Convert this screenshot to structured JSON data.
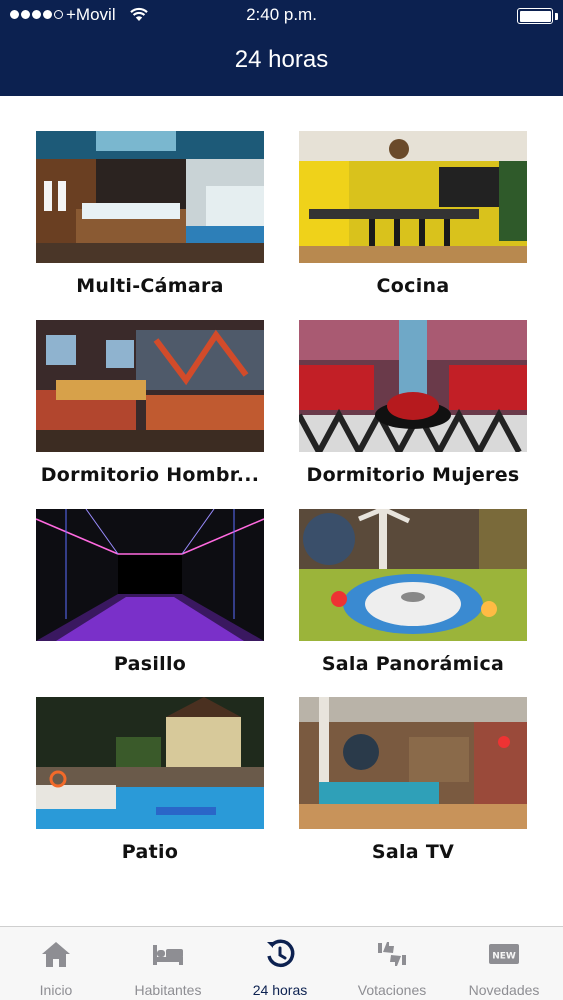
{
  "status_bar": {
    "carrier": "+Movil",
    "time": "2:40 p.m."
  },
  "header": {
    "title": "24 horas"
  },
  "rooms": [
    {
      "label": "Multi-Cámara"
    },
    {
      "label": "Cocina"
    },
    {
      "label": "Dormitorio Hombr..."
    },
    {
      "label": "Dormitorio Mujeres"
    },
    {
      "label": "Pasillo"
    },
    {
      "label": "Sala Panorámica"
    },
    {
      "label": "Patio"
    },
    {
      "label": "Sala TV"
    }
  ],
  "tabbar": {
    "items": [
      {
        "label": "Inicio",
        "icon": "home-icon"
      },
      {
        "label": "Habitantes",
        "icon": "bed-icon"
      },
      {
        "label": "24 horas",
        "icon": "clock-refresh-icon",
        "active": true
      },
      {
        "label": "Votaciones",
        "icon": "thumbs-icon"
      },
      {
        "label": "Novedades",
        "icon": "new-badge-icon"
      }
    ]
  },
  "colors": {
    "header_bg": "#0c2150",
    "tab_inactive": "#8e8e93",
    "tab_active": "#0c2150"
  }
}
